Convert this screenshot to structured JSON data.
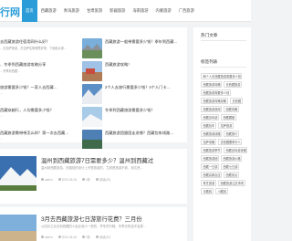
{
  "header": {
    "logo": "行网",
    "nav": [
      {
        "label": "首页",
        "active": true
      },
      {
        "label": "西藏旅游"
      },
      {
        "label": "青海旅游"
      },
      {
        "label": "甘肃旅游"
      },
      {
        "label": "新疆旅游"
      },
      {
        "label": "海南旅游"
      },
      {
        "label": "内蒙旅游"
      },
      {
        "label": "广西旅游"
      }
    ]
  },
  "top_posts": [
    {
      "left": {
        "title": "去西藏旅游住宿用网什么好？",
        "excerpt": "…去拉萨旅游，在拉萨住宿哪里好呢，下面给大家…"
      },
      "right": {
        "title": "西藏旅游一般带需要多少钱？季年到西藏…",
        "excerpt": "…"
      }
    },
    {
      "left": {
        "title": "、冬季到西藏旅游攻略分享",
        "excerpt": "…冬季到西藏…"
      },
      "right": {
        "title": "西藏旅游攻略！",
        "excerpt": "…"
      }
    },
    {
      "left": {
        "title": "旅游需要多少钱？一家人去西藏…",
        "excerpt": "…"
      },
      "right": {
        "title": "2个人去旅行需要多少钱？4个人门卡…",
        "excerpt": "…"
      }
    },
    {
      "left": {
        "title": "西藏穿越行，人均需要多少钱？",
        "excerpt": "…"
      },
      "right": {
        "title": "冬季到西藏旅游需要多少钱？",
        "excerpt": "…"
      }
    },
    {
      "left": {
        "title": "西藏旅游需带带怎么样？第一次去西藏…",
        "excerpt": "…"
      },
      "right": {
        "title": "西藏旅游团跟团走进哪？西藏包车线路…",
        "excerpt": "…"
      }
    }
  ],
  "big_posts": [
    {
      "title": "温州到西藏旅游7日需要多少？温州到西藏过",
      "excerpt": "温州到西藏旅游，在路线的设计上不是旅游的，尤其是旅游不到，到达西…",
      "meta": [
        "admin",
        "2020-06-26",
        "0条",
        "阅读(25)"
      ]
    },
    {
      "title": "3月去西藏旅游七日游旅行花费？三月份",
      "excerpt": "从四月之后去到西藏的人会比较少一些的，早冬的行程、冬季去的话不会是…",
      "meta": [
        "admin",
        "2020-06-26",
        "0条",
        "阅读(32)"
      ]
    }
  ],
  "sidebar": {
    "hot_title": "热门文章",
    "tags_title": "标签列表",
    "tags": [
      "两个人去西藏旅游需要多少钱",
      "西藏旅游攻略",
      "去西藏旅游",
      "西藏旅游需要多少钱",
      "西藏旅游攻略攻略",
      "去西藏",
      "西藏旅游费用",
      "西藏攻略",
      "西藏自驾游",
      "西藏跟团",
      "西藏包车",
      "拉萨旅游",
      "西藏旅游线路",
      "西藏旅行",
      "拉萨攻略",
      "去西藏要带什么",
      "西藏旅游季节",
      "西藏自驾游攻略",
      "西藏旅游团",
      "西藏旅游价格",
      "西藏一日游",
      "西藏七日游",
      "西藏高原反应",
      "西藏景点",
      "林芝旅游",
      "西藏旅游注意事项",
      "青藏线",
      "川藏线"
    ]
  }
}
